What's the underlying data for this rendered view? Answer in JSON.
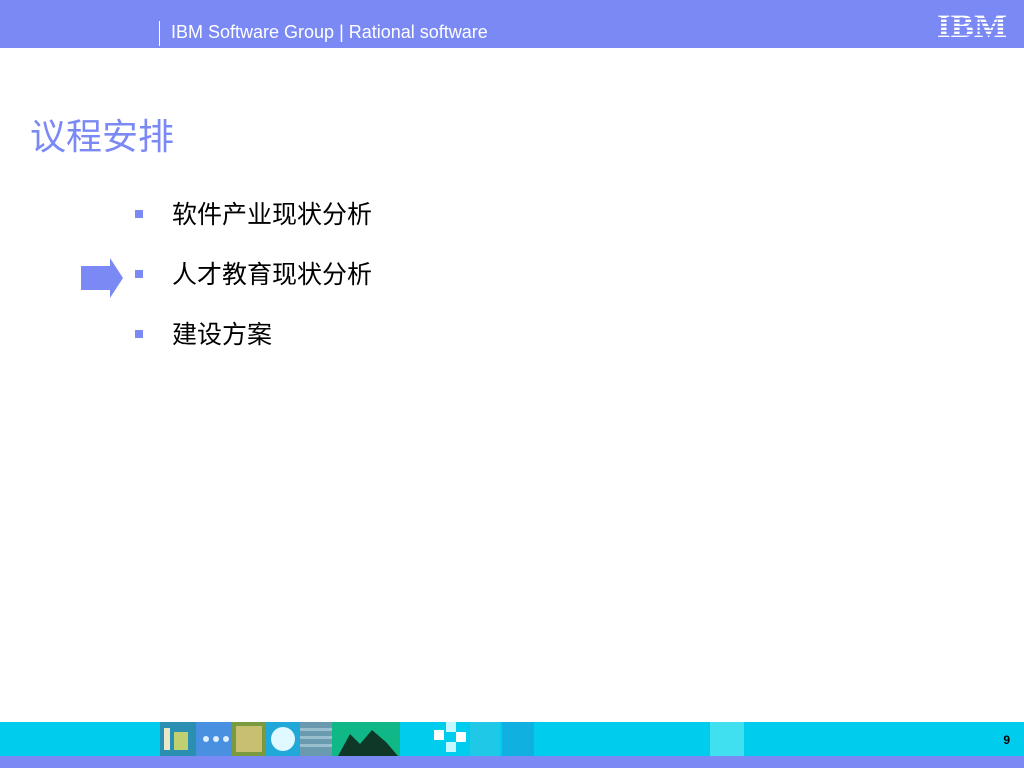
{
  "header": {
    "title": "IBM Software Group | Rational software",
    "logo_text": "IBM"
  },
  "page": {
    "title": "议程安排",
    "number": "9"
  },
  "bullets": [
    {
      "text": "软件产业现状分析"
    },
    {
      "text": "人才教育现状分析",
      "current": true
    },
    {
      "text": "建设方案"
    }
  ],
  "colors": {
    "header": "#7b89f5",
    "accent": "#7b89f5",
    "footer": "#00ccee",
    "text": "#000000"
  },
  "icons": {
    "arrow": "arrow-right-icon",
    "bullet": "square-bullet-icon"
  }
}
